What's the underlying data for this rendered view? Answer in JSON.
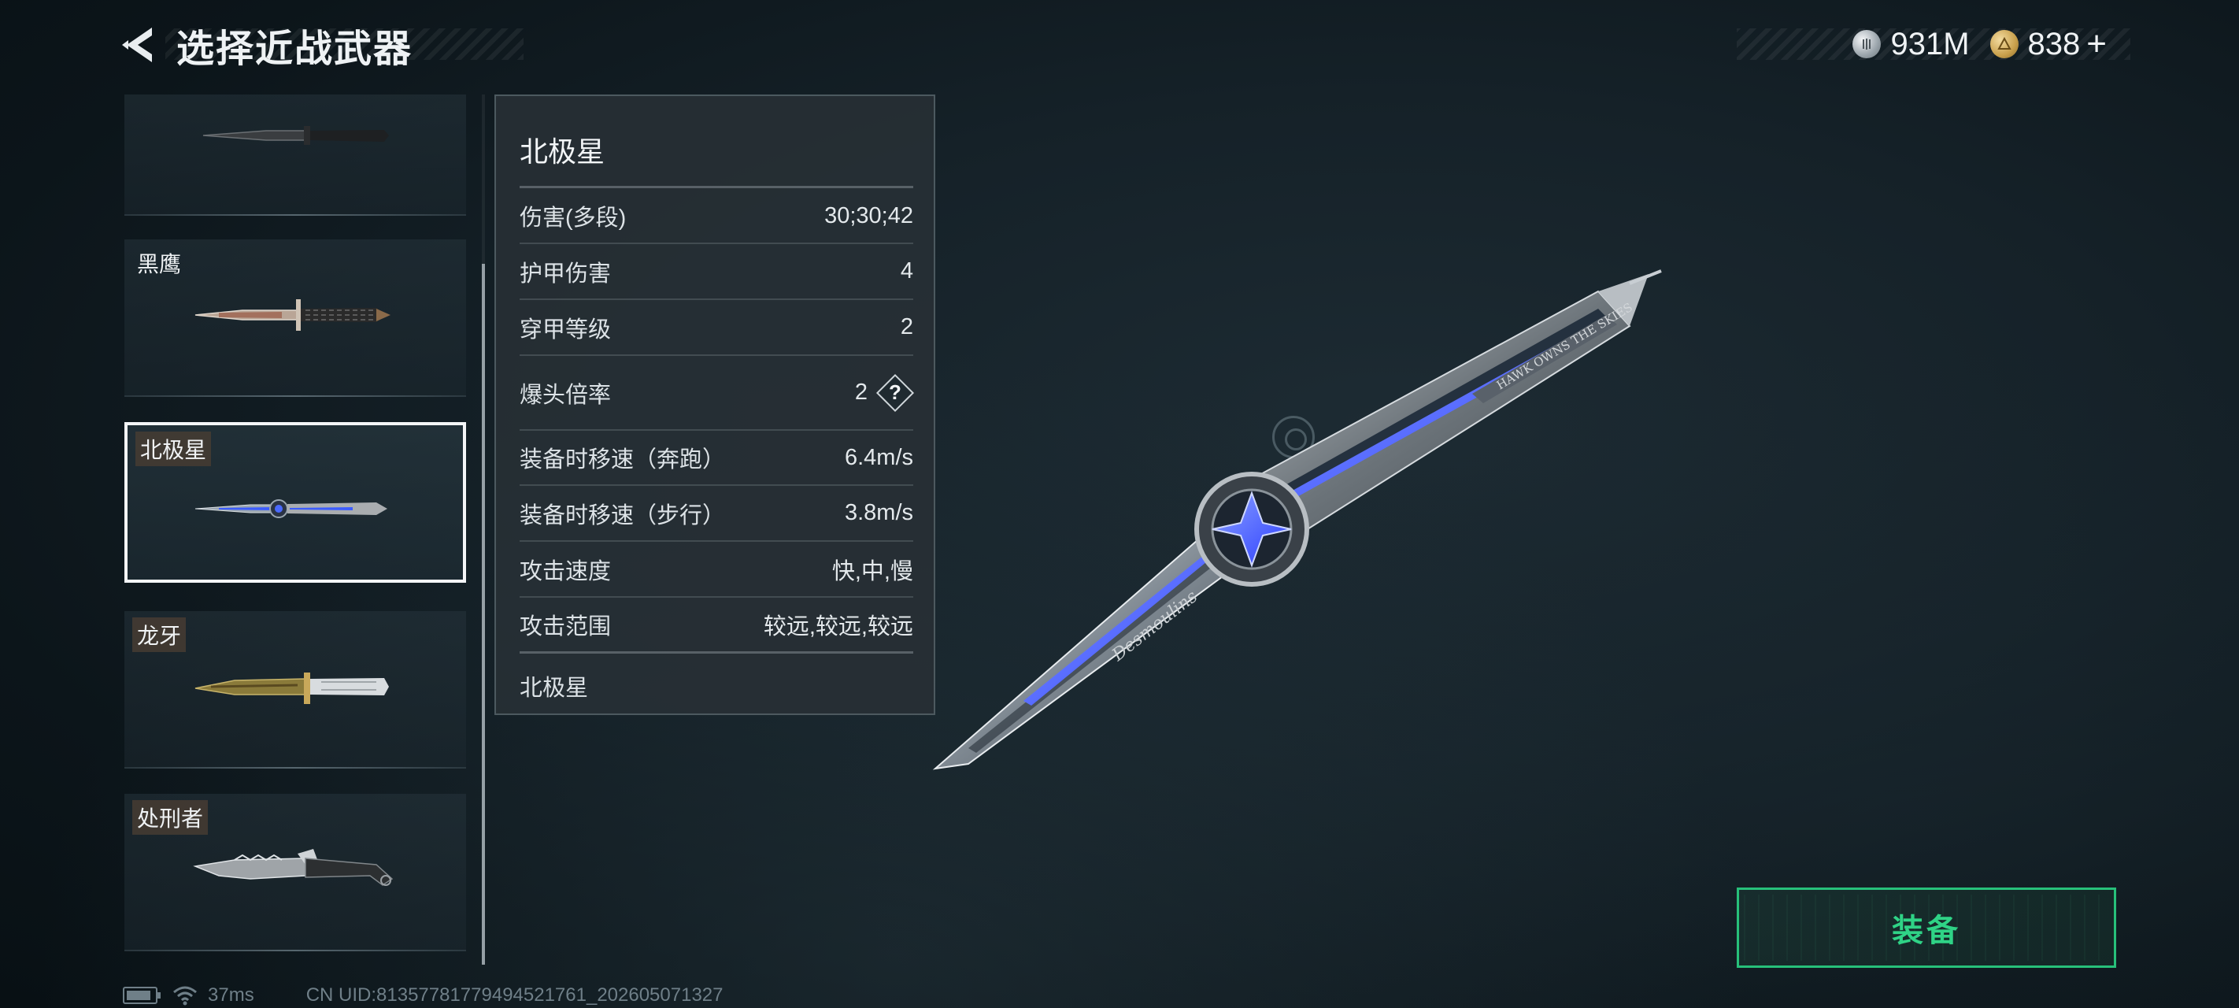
{
  "header": {
    "title": "选择近战武器",
    "back_icon": "back-arrow-icon"
  },
  "currency": {
    "silver": {
      "icon": "silver-coin-icon",
      "amount": "931M"
    },
    "gold": {
      "icon": "gold-coin-icon",
      "amount": "838",
      "plus": "+"
    }
  },
  "weapon_list": {
    "items": [
      {
        "name": "",
        "icon": "combat-knife-icon"
      },
      {
        "name": "黑鹰",
        "icon": "black-hawk-knife-icon"
      },
      {
        "name": "北极星",
        "icon": "polaris-knife-icon",
        "selected": true
      },
      {
        "name": "龙牙",
        "icon": "dragon-fang-knife-icon"
      },
      {
        "name": "处刑者",
        "icon": "executioner-knife-icon"
      }
    ]
  },
  "stats": {
    "title": "北极星",
    "rows": [
      {
        "label": "伤害(多段)",
        "value": "30;30;42"
      },
      {
        "label": "护甲伤害",
        "value": "4"
      },
      {
        "label": "穿甲等级",
        "value": "2"
      },
      {
        "label": "爆头倍率",
        "value": "2",
        "help": "?"
      },
      {
        "label": "装备时移速（奔跑）",
        "value": "6.4m/s"
      },
      {
        "label": "装备时移速（步行）",
        "value": "3.8m/s"
      },
      {
        "label": "攻击速度",
        "value": "快,中,慢"
      },
      {
        "label": "攻击范围",
        "value": "较远,较远,较远"
      }
    ],
    "footer": "北极星"
  },
  "hero_weapon": {
    "icon": "polaris-knife-hero",
    "engraving_blade": "Desmoulins",
    "engraving_handle": "HAWK OWNS THE SKIES"
  },
  "equip_button": {
    "label": "装备"
  },
  "status_bar": {
    "ping": "37ms",
    "uid": "CN UID:81357781779494521761_202605071327"
  },
  "colors": {
    "accent_green": "#2fd386",
    "selected_border": "#f4f6f8",
    "background": "#152128"
  }
}
